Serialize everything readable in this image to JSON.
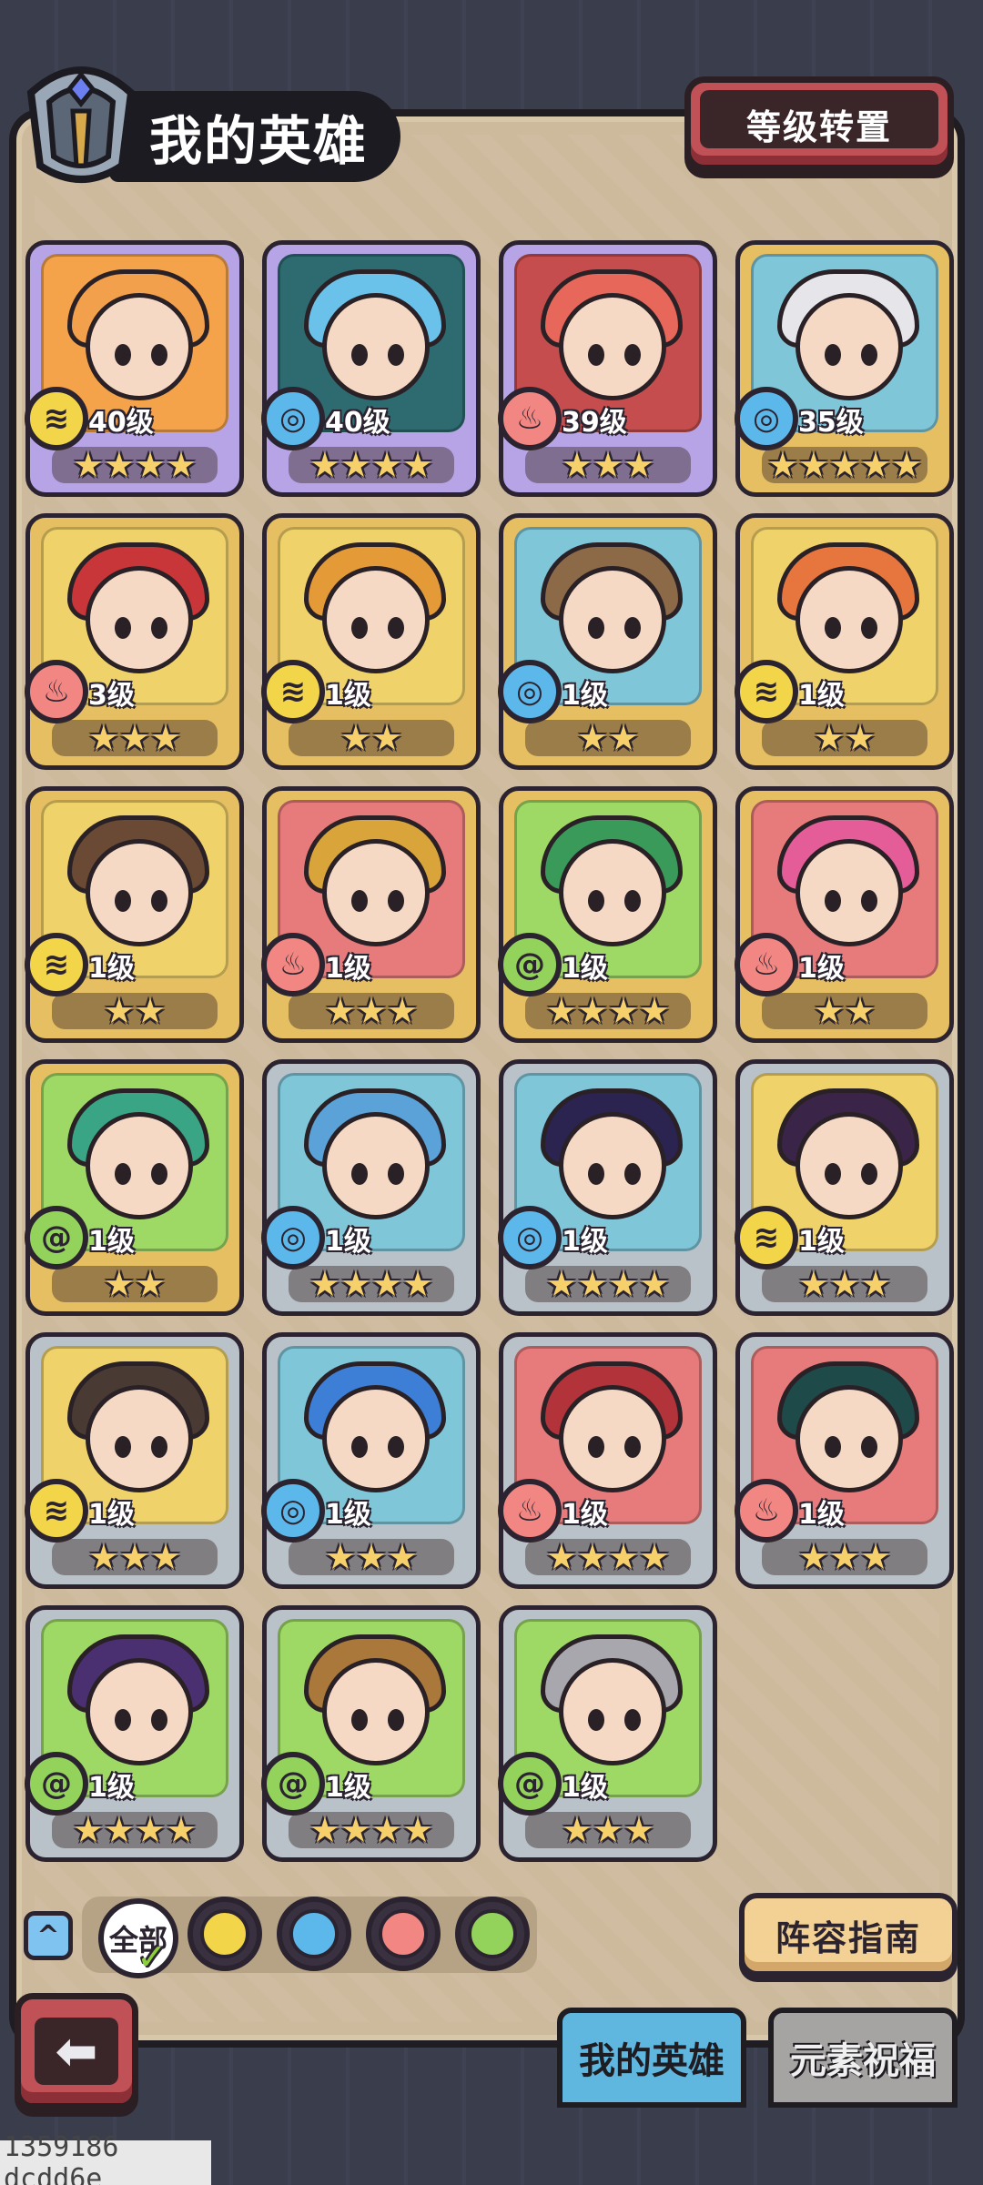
{
  "header": {
    "title": "我的英雄",
    "reset_button": "等级转置"
  },
  "heroes": [
    {
      "level": "40级",
      "stars": "★★★★",
      "element": "earth",
      "frame": "purple",
      "portrait_bg": "#f5a34a",
      "hair": "#f2a04c"
    },
    {
      "level": "40级",
      "stars": "★★★★",
      "element": "water",
      "frame": "purple",
      "portrait_bg": "#2d6b70",
      "hair": "#6ac2ea"
    },
    {
      "level": "39级",
      "stars": "★★★",
      "element": "fire",
      "frame": "purple",
      "portrait_bg": "#c54d4d",
      "hair": "#e7675a"
    },
    {
      "level": "35级",
      "stars": "★★★★★",
      "element": "water",
      "frame": "gold",
      "portrait_bg": "#7fc6d8",
      "hair": "#e6e6ea"
    },
    {
      "level": "3级",
      "stars": "★★★",
      "element": "fire",
      "frame": "gold",
      "portrait_bg": "#f0d26a",
      "hair": "#c9363a"
    },
    {
      "level": "1级",
      "stars": "★★",
      "element": "earth",
      "frame": "gold",
      "portrait_bg": "#f0d26a",
      "hair": "#e59a38"
    },
    {
      "level": "1级",
      "stars": "★★",
      "element": "water",
      "frame": "gold",
      "portrait_bg": "#7fc6d8",
      "hair": "#8c6a48"
    },
    {
      "level": "1级",
      "stars": "★★",
      "element": "earth",
      "frame": "gold",
      "portrait_bg": "#f0d26a",
      "hair": "#e6763e"
    },
    {
      "level": "1级",
      "stars": "★★",
      "element": "earth",
      "frame": "gold",
      "portrait_bg": "#f0d26a",
      "hair": "#6a4a34"
    },
    {
      "level": "1级",
      "stars": "★★★",
      "element": "fire",
      "frame": "gold",
      "portrait_bg": "#e77b7b",
      "hair": "#d9a53a"
    },
    {
      "level": "1级",
      "stars": "★★★★",
      "element": "wind",
      "frame": "gold",
      "portrait_bg": "#9ed865",
      "hair": "#3a9a5a"
    },
    {
      "level": "1级",
      "stars": "★★",
      "element": "fire",
      "frame": "gold",
      "portrait_bg": "#e77b7b",
      "hair": "#e55d98"
    },
    {
      "level": "1级",
      "stars": "★★",
      "element": "wind",
      "frame": "gold",
      "portrait_bg": "#9ed865",
      "hair": "#3aa585"
    },
    {
      "level": "1级",
      "stars": "★★★★",
      "element": "water",
      "frame": "silver",
      "portrait_bg": "#7fc6d8",
      "hair": "#5aa2d8"
    },
    {
      "level": "1级",
      "stars": "★★★★",
      "element": "water",
      "frame": "silver",
      "portrait_bg": "#7fc6d8",
      "hair": "#2b2350"
    },
    {
      "level": "1级",
      "stars": "★★★",
      "element": "earth",
      "frame": "silver",
      "portrait_bg": "#f0d26a",
      "hair": "#3a2448"
    },
    {
      "level": "1级",
      "stars": "★★★",
      "element": "earth",
      "frame": "silver",
      "portrait_bg": "#f0d26a",
      "hair": "#4a3a34"
    },
    {
      "level": "1级",
      "stars": "★★★",
      "element": "water",
      "frame": "silver",
      "portrait_bg": "#7fc6d8",
      "hair": "#3d7fd6"
    },
    {
      "level": "1级",
      "stars": "★★★★",
      "element": "fire",
      "frame": "silver",
      "portrait_bg": "#e77b7b",
      "hair": "#b2333a"
    },
    {
      "level": "1级",
      "stars": "★★★",
      "element": "fire",
      "frame": "silver",
      "portrait_bg": "#e77b7b",
      "hair": "#1f4a4a"
    },
    {
      "level": "1级",
      "stars": "★★★★",
      "element": "wind",
      "frame": "silver",
      "portrait_bg": "#9ed865",
      "hair": "#4a3070"
    },
    {
      "level": "1级",
      "stars": "★★★★",
      "element": "wind",
      "frame": "silver",
      "portrait_bg": "#9ed865",
      "hair": "#a9783a"
    },
    {
      "level": "1级",
      "stars": "★★★",
      "element": "wind",
      "frame": "silver",
      "portrait_bg": "#9ed865",
      "hair": "#a7a7ad"
    }
  ],
  "filter": {
    "all_label": "全部",
    "elements": [
      "earth",
      "water",
      "fire",
      "wind"
    ]
  },
  "guide_button": "阵容指南",
  "tabs": {
    "my_heroes": "我的英雄",
    "element_blessing": "元素祝福"
  },
  "footer_id": "1359186 dcdd6e",
  "colors": {
    "earth": "#f2d548",
    "water": "#5cb7ea",
    "fire": "#f18682",
    "wind": "#93d35c"
  }
}
